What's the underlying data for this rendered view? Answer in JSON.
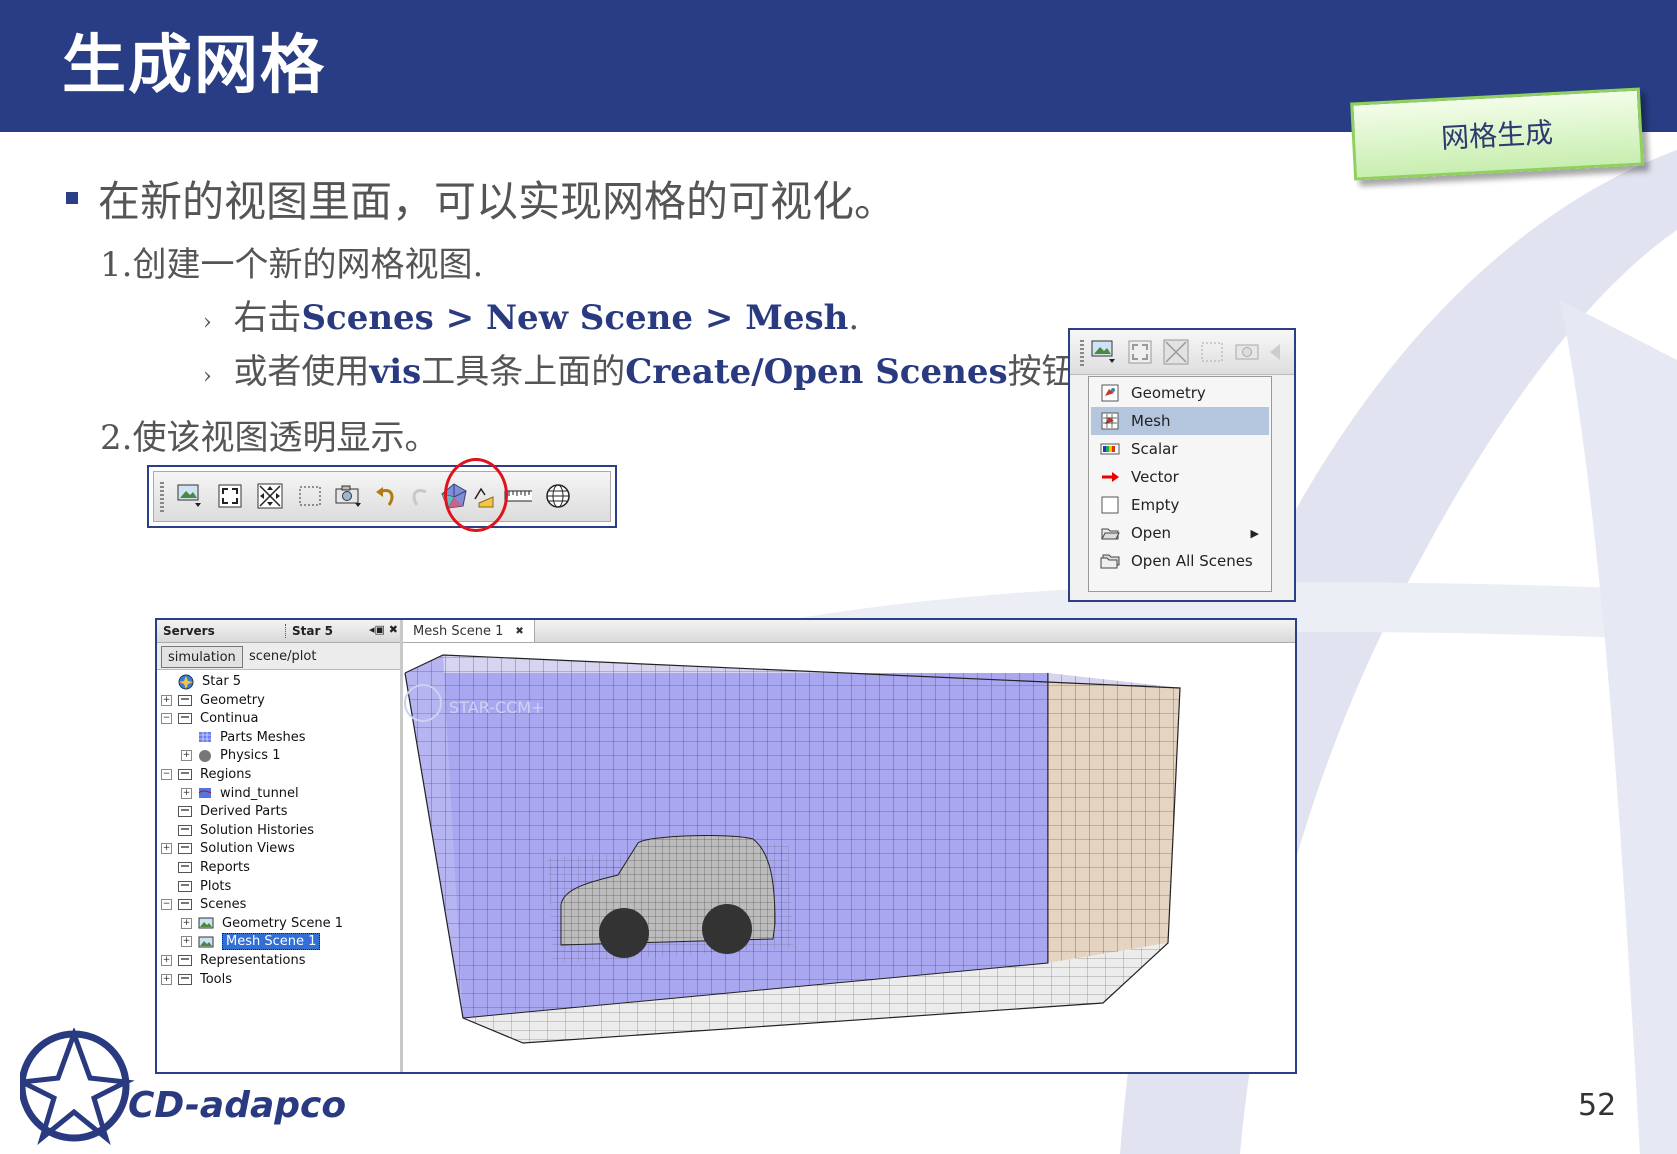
{
  "header": {
    "title": "生成网格",
    "section_tag": "网格生成"
  },
  "body": {
    "main_bullet": "在新的视图里面，可以实现网格的可视化。",
    "step1": "1.创建一个新的网格视图.",
    "sub1_prefix": "右击",
    "sub1_bold": "Scenes > New Scene > Mesh",
    "sub1_suffix": ".",
    "sub2_prefix": "或者使用",
    "sub2_bold1": "vis",
    "sub2_mid": "工具条上面的",
    "sub2_bold2": "Create/Open Scenes",
    "sub2_suffix": "按钮:",
    "step2": "2.使该视图透明显示。",
    "arrow": "›"
  },
  "scene_menu": {
    "items": [
      {
        "label": "Geometry",
        "icon": "geometry-scene-icon",
        "selected": false
      },
      {
        "label": "Mesh",
        "icon": "mesh-scene-icon",
        "selected": true
      },
      {
        "label": "Scalar",
        "icon": "scalar-scene-icon",
        "selected": false
      },
      {
        "label": "Vector",
        "icon": "vector-scene-icon",
        "selected": false
      },
      {
        "label": "Empty",
        "icon": "empty-scene-icon",
        "selected": false
      },
      {
        "label": "Open",
        "icon": "open-scene-icon",
        "selected": false,
        "submenu": true
      },
      {
        "label": "Open All Scenes",
        "icon": "open-all-scenes-icon",
        "selected": false
      }
    ]
  },
  "simulation_panel": {
    "left_tabs": {
      "servers": "Servers",
      "star": "Star 5"
    },
    "subtabs": {
      "simulation": "simulation",
      "scene_plot": "scene/plot"
    },
    "tree": [
      {
        "label": "Star 5",
        "depth": 0,
        "expander": "none",
        "icon": "star-root"
      },
      {
        "label": "Geometry",
        "depth": 0,
        "expander": "plus",
        "icon": "folder"
      },
      {
        "label": "Continua",
        "depth": 0,
        "expander": "minus",
        "icon": "folder"
      },
      {
        "label": "Parts Meshes",
        "depth": 1,
        "expander": "none",
        "icon": "mesh"
      },
      {
        "label": "Physics 1",
        "depth": 1,
        "expander": "plus",
        "icon": "physics"
      },
      {
        "label": "Regions",
        "depth": 0,
        "expander": "minus",
        "icon": "folder"
      },
      {
        "label": "wind_tunnel",
        "depth": 1,
        "expander": "plus",
        "icon": "region"
      },
      {
        "label": "Derived Parts",
        "depth": 0,
        "expander": "none",
        "icon": "folder"
      },
      {
        "label": "Solution Histories",
        "depth": 0,
        "expander": "none",
        "icon": "folder"
      },
      {
        "label": "Solution Views",
        "depth": 0,
        "expander": "plus",
        "icon": "folder"
      },
      {
        "label": "Reports",
        "depth": 0,
        "expander": "none",
        "icon": "folder"
      },
      {
        "label": "Plots",
        "depth": 0,
        "expander": "none",
        "icon": "folder"
      },
      {
        "label": "Scenes",
        "depth": 0,
        "expander": "minus",
        "icon": "folder"
      },
      {
        "label": "Geometry Scene 1",
        "depth": 1,
        "expander": "plus",
        "icon": "scene"
      },
      {
        "label": "Mesh Scene 1",
        "depth": 1,
        "expander": "plus",
        "icon": "scene",
        "selected": true
      },
      {
        "label": "Representations",
        "depth": 0,
        "expander": "plus",
        "icon": "folder"
      },
      {
        "label": "Tools",
        "depth": 0,
        "expander": "plus",
        "icon": "folder"
      }
    ],
    "scene_tab": "Mesh Scene 1",
    "watermark": "STAR-CCM+"
  },
  "footer": {
    "page_number": "52",
    "logo_text": "CD-adapco"
  },
  "colors": {
    "header": "#283d84",
    "accent_red": "#e0121b",
    "mesh_blue": "#a9a7f0",
    "selection": "#b3c6de"
  }
}
